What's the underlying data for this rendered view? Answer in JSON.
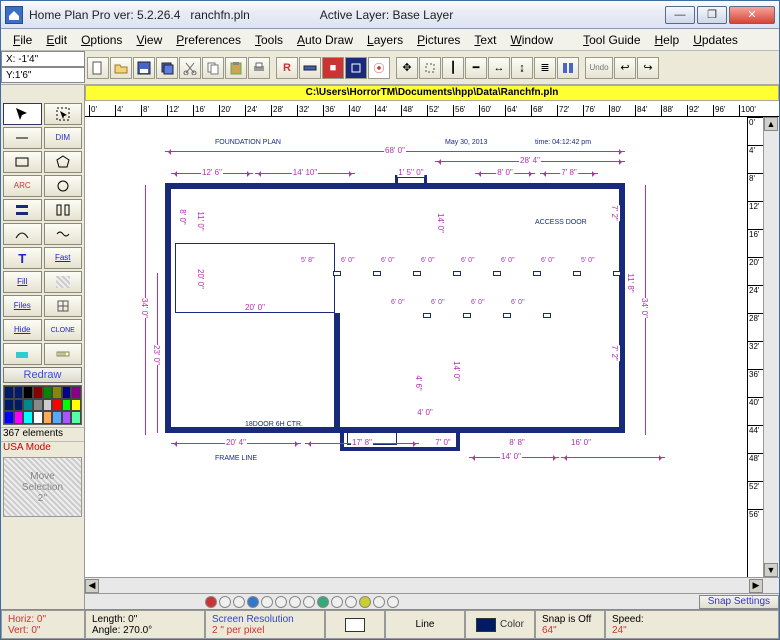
{
  "titlebar": {
    "app": "Home Plan Pro ver: 5.2.26.4",
    "file": "ranchfn.pln",
    "layer_label": "Active Layer: Base Layer"
  },
  "menu": [
    "File",
    "Edit",
    "Options",
    "View",
    "Preferences",
    "Tools",
    "Auto Draw",
    "Layers",
    "Pictures",
    "Text",
    "Window",
    "Tool Guide",
    "Help",
    "Updates"
  ],
  "coords": {
    "x": "X: -1'4\"",
    "y": "Y:1'6\""
  },
  "path": "C:\\Users\\HorrorTM\\Documents\\hpp\\Data\\Ranchfn.pln",
  "ruler_x": [
    "0'",
    "4'",
    "8'",
    "12'",
    "16'",
    "20'",
    "24'",
    "28'",
    "32'",
    "36'",
    "40'",
    "44'",
    "48'",
    "52'",
    "56'",
    "60'",
    "64'",
    "68'",
    "72'",
    "76'",
    "80'",
    "84'",
    "88'",
    "92'",
    "96'",
    "100'"
  ],
  "ruler_y": [
    "0'",
    "4'",
    "8'",
    "12'",
    "16'",
    "20'",
    "24'",
    "28'",
    "32'",
    "36'",
    "40'",
    "44'",
    "48'",
    "52'",
    "56'"
  ],
  "left_status": {
    "elements": "367 elements",
    "mode": "USA Mode",
    "move": "Move\nSelection\n2''"
  },
  "redraw": "Redraw",
  "tools": {
    "arc": "ARC",
    "dim": "DIM",
    "fast": "Fast",
    "text": "T",
    "fill": "Fill",
    "files": "Files",
    "hide": "Hide",
    "clone": "CLONE"
  },
  "snap_settings": "Snap Settings",
  "status": {
    "horiz": "Horiz: 0\"",
    "vert": "Vert:  0\"",
    "length": "Length:  0\"",
    "angle": "Angle:  270.0°",
    "res_a": "Screen Resolution",
    "res_b": "2 \" per pixel",
    "drawmode": "Line",
    "color": "Color",
    "snap": "Snap is Off",
    "snapv": "64\"",
    "speed": "Speed:",
    "speedv": "24\""
  },
  "undo": "Undo",
  "plan": {
    "title": "FOUNDATION PLAN",
    "date": "May 30, 2013",
    "time": "time: 04:12:42 pm",
    "overall_w": "68' 0\"",
    "right_w": "28' 4\"",
    "top_dims": [
      "12' 6\"",
      "14' 10\"",
      "8' 0\"",
      "7' 8\""
    ],
    "top_mid": "1' 5'' 0''",
    "left_h": "34' 0\"",
    "left_h2": "23' 0\"",
    "left_h3": "8' 0\"",
    "left_h4": "11' 0\"",
    "left_h5": "20' 0\"",
    "right_h": "34' 0\"",
    "right_h2": "11' 8\"",
    "right_h3": "7' 2\"",
    "right_h4": "7' 2\"",
    "right_h5": "14' 0\"",
    "bottom_dims": [
      "20' 4\"",
      "17' 8\"",
      "7' 0\"",
      "8' 8\"",
      "14' 0\"",
      "16' 0\""
    ],
    "inner_w": "20' 0\"",
    "inner_h": "14' 0\"",
    "access": "ACCESS DOOR",
    "row1": [
      "5' 8\"",
      "6' 0\"",
      "6' 0\"",
      "6' 0\"",
      "6' 0\"",
      "6' 0\"",
      "6' 0\"",
      "5' 0\""
    ],
    "row2": [
      "6' 0\"",
      "6' 0\"",
      "6' 0\"",
      "6' 0\""
    ],
    "row2b": "4' 0\"",
    "small": "4' 6\"",
    "frame": "FRAME LINE",
    "door": "18DOOR 6H CTR."
  }
}
